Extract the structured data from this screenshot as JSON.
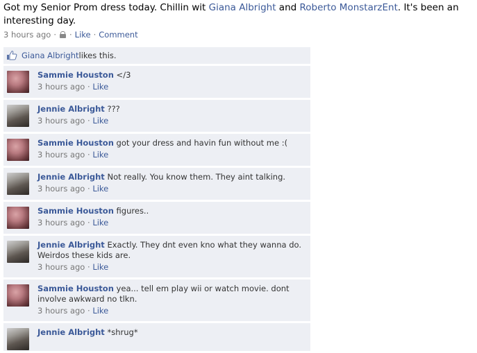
{
  "status": {
    "text_part1": "Got my Senior Prom dress today. Chillin wit ",
    "tag1": "Giana Albright",
    "text_part2": " and ",
    "tag2": "Roberto MonstarzEnt",
    "text_part3": ". It's been an interesting day."
  },
  "post_meta": {
    "time": "3 hours ago",
    "sep": "·",
    "like": "Like",
    "comment": "Comment"
  },
  "likes": {
    "name": "Giana Albright",
    "text": " likes this."
  },
  "comments": [
    {
      "name": "Sammie Houston",
      "text": " </3",
      "time": "3 hours ago",
      "like": "Like",
      "avatar": "sammie"
    },
    {
      "name": "Jennie Albright",
      "text": " ???",
      "time": "3 hours ago",
      "like": "Like",
      "avatar": "jennie"
    },
    {
      "name": "Sammie Houston",
      "text": " got your dress and havin fun without me :(",
      "time": "3 hours ago",
      "like": "Like",
      "avatar": "sammie"
    },
    {
      "name": "Jennie Albright",
      "text": " Not really. You know them. They aint talking.",
      "time": "3 hours ago",
      "like": "Like",
      "avatar": "jennie"
    },
    {
      "name": "Sammie Houston",
      "text": " figures..",
      "time": "3 hours ago",
      "like": "Like",
      "avatar": "sammie"
    },
    {
      "name": "Jennie Albright",
      "text": " Exactly. They dnt even kno what they wanna do. Weirdos these kids are.",
      "time": "3 hours ago",
      "like": "Like",
      "avatar": "jennie"
    },
    {
      "name": "Sammie Houston",
      "text": " yea... tell em play wii or watch movie. dont involve awkward no tlkn.",
      "time": "3 hours ago",
      "like": "Like",
      "avatar": "sammie"
    },
    {
      "name": "Jennie Albright",
      "text": " *shrug*",
      "time": "",
      "like": "",
      "avatar": "jennie"
    }
  ],
  "colors": {
    "link": "#3b5998",
    "comment_bg": "#edeff4",
    "meta": "#777777"
  },
  "icons": {
    "privacy": "lock-icon",
    "like": "thumbs-up-icon"
  }
}
